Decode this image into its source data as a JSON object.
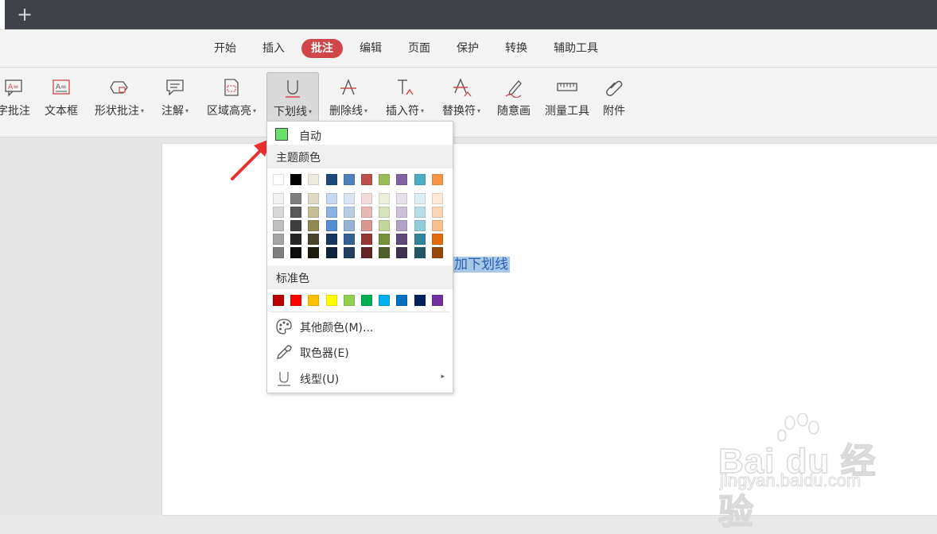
{
  "titlebar": {
    "new_tab_icon": "plus-icon"
  },
  "menu": {
    "tabs": [
      {
        "label": "开始",
        "active": false
      },
      {
        "label": "插入",
        "active": false
      },
      {
        "label": "批注",
        "active": true
      },
      {
        "label": "编辑",
        "active": false
      },
      {
        "label": "页面",
        "active": false
      },
      {
        "label": "保护",
        "active": false
      },
      {
        "label": "转换",
        "active": false
      },
      {
        "label": "辅助工具",
        "active": false
      }
    ],
    "active_color": "#d0474a"
  },
  "toolbar": {
    "tools": [
      {
        "label": "字批注",
        "icon": "text-comment-icon",
        "dropdown": false
      },
      {
        "label": "文本框",
        "icon": "text-box-icon",
        "dropdown": false
      },
      {
        "label": "形状批注",
        "icon": "shape-comment-icon",
        "dropdown": true
      },
      {
        "label": "注解",
        "icon": "note-icon",
        "dropdown": true
      },
      {
        "label": "区域高亮",
        "icon": "area-highlight-icon",
        "dropdown": true
      },
      {
        "label": "下划线",
        "icon": "underline-icon",
        "dropdown": true,
        "selected": true
      },
      {
        "label": "删除线",
        "icon": "strikethrough-icon",
        "dropdown": true
      },
      {
        "label": "插入符",
        "icon": "insert-caret-icon",
        "dropdown": true
      },
      {
        "label": "替换符",
        "icon": "replace-caret-icon",
        "dropdown": true
      },
      {
        "label": "随意画",
        "icon": "freehand-pen-icon",
        "dropdown": false
      },
      {
        "label": "测量工具",
        "icon": "ruler-icon",
        "dropdown": false
      },
      {
        "label": "附件",
        "icon": "paperclip-icon",
        "dropdown": false
      }
    ]
  },
  "document": {
    "highlighted_text": "加下划线",
    "highlight_color": "#a7c8e8"
  },
  "dropdown": {
    "auto_label": "自动",
    "auto_color": "#6be06b",
    "theme_heading": "主题颜色",
    "theme_top_row": [
      "#ffffff",
      "#000000",
      "#eeece1",
      "#1f497d",
      "#4f81bd",
      "#c0504d",
      "#9bbb59",
      "#8064a2",
      "#4bacc6",
      "#f79646"
    ],
    "theme_shades": [
      [
        "#f2f2f2",
        "#d8d8d8",
        "#bfbfbf",
        "#a5a5a5",
        "#7f7f7f"
      ],
      [
        "#7f7f7f",
        "#595959",
        "#3f3f3f",
        "#262626",
        "#0c0c0c"
      ],
      [
        "#ddd9c3",
        "#c4bd97",
        "#938953",
        "#494429",
        "#1d1b10"
      ],
      [
        "#c6d9f0",
        "#8db3e2",
        "#548dd4",
        "#17365d",
        "#0f243e"
      ],
      [
        "#dbe5f1",
        "#b8cce4",
        "#95b3d7",
        "#366092",
        "#244061"
      ],
      [
        "#f2dcdb",
        "#e5b9b7",
        "#d99694",
        "#953734",
        "#632423"
      ],
      [
        "#ebf1dd",
        "#d7e3bc",
        "#c3d69b",
        "#76923c",
        "#4f6128"
      ],
      [
        "#e5e0ec",
        "#ccc1d9",
        "#b2a2c7",
        "#5f497a",
        "#3f3151"
      ],
      [
        "#dbeef3",
        "#b7dde8",
        "#92cddc",
        "#31859b",
        "#205867"
      ],
      [
        "#fdeada",
        "#fbd5b5",
        "#fac08f",
        "#e36c09",
        "#974806"
      ]
    ],
    "standard_heading": "标准色",
    "standard_colors": [
      "#c00000",
      "#ff0000",
      "#ffc000",
      "#ffff00",
      "#92d050",
      "#00b050",
      "#00b0f0",
      "#0070c0",
      "#002060",
      "#7030a0"
    ],
    "more_colors_label": "其他颜色(M)...",
    "more_colors_icon": "palette-icon",
    "eyedropper_label": "取色器(E)",
    "eyedropper_icon": "eyedropper-icon",
    "line_style_label": "线型(U)",
    "line_style_icon": "underline-icon"
  },
  "watermark": {
    "brand": "Bai du 经验",
    "url": "jingyan.baidu.com"
  }
}
